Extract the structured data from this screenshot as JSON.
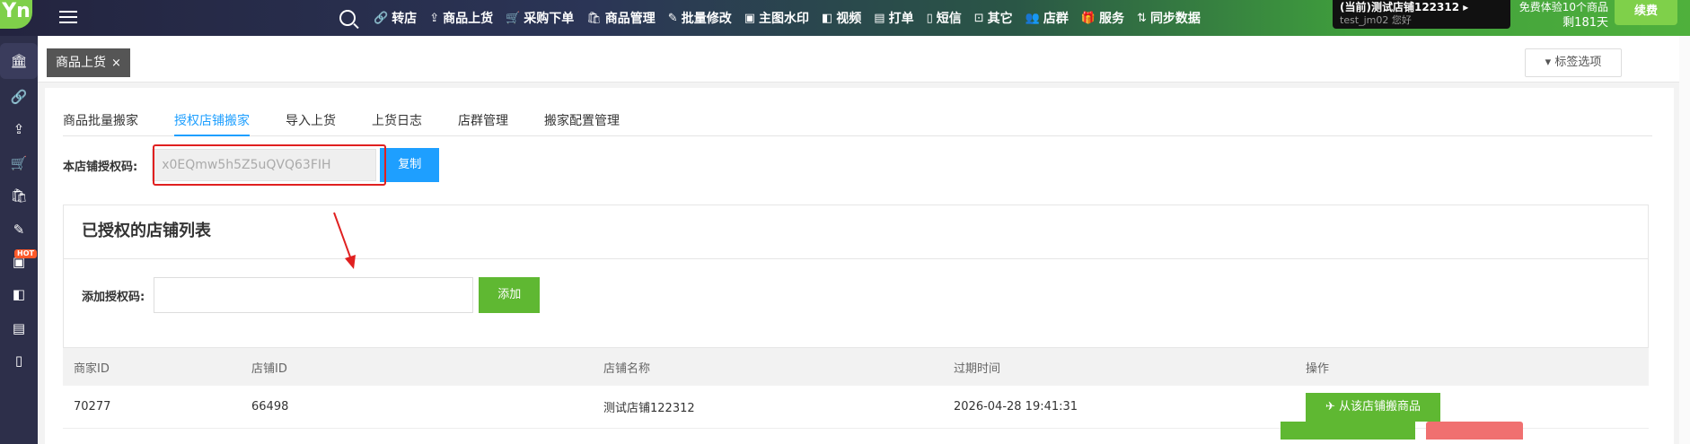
{
  "topbar": {
    "logo": "Yn",
    "nav": [
      {
        "icon": "🔗",
        "label": "转店"
      },
      {
        "icon": "⇪",
        "label": "商品上货"
      },
      {
        "icon": "🛒",
        "label": "采购下单"
      },
      {
        "icon": "🛍",
        "label": "商品管理"
      },
      {
        "icon": "✎",
        "label": "批量修改"
      },
      {
        "icon": "▣",
        "label": "主图水印"
      },
      {
        "icon": "◧",
        "label": "视频"
      },
      {
        "icon": "▤",
        "label": "打单"
      },
      {
        "icon": "▯",
        "label": "短信"
      },
      {
        "icon": "⊡",
        "label": "其它"
      },
      {
        "icon": "👥",
        "label": "店群"
      },
      {
        "icon": "🎁",
        "label": "服务"
      },
      {
        "icon": "⇅",
        "label": "同步数据"
      }
    ],
    "shop_name": "(当前)测试店铺122312 ▸",
    "user_greeting": "test_jm02 您好",
    "trial_text": "免费体验10个商品",
    "days_left": "剩181天",
    "renew_label": "续费"
  },
  "sidebar": {
    "icons": [
      "bank-icon",
      "link-icon",
      "upload-icon",
      "cart-icon",
      "bag-icon",
      "edit-icon",
      "image-hot-icon",
      "video-icon",
      "print-icon",
      "phone-icon"
    ],
    "hot_badge": "HOT"
  },
  "tabs": {
    "active_tag": "商品上货",
    "close": "×",
    "options_label": "▾ 标签选项"
  },
  "subtabs": [
    "商品批量搬家",
    "授权店铺搬家",
    "导入上货",
    "上货日志",
    "店群管理",
    "搬家配置管理"
  ],
  "auth": {
    "label": "本店铺授权码:",
    "code": "x0EQmw5h5Z5uQVQ63FIH",
    "copy_label": "复制"
  },
  "card": {
    "title": "已授权的店铺列表",
    "add_label": "添加授权码:",
    "add_placeholder": "",
    "add_button": "添加"
  },
  "table": {
    "headers": [
      "商家ID",
      "店铺ID",
      "店铺名称",
      "过期时间",
      "操作"
    ],
    "rows": [
      {
        "merchant_id": "70277",
        "shop_id": "66498",
        "shop_name": "测试店铺122312",
        "expire": "2026-04-28 19:41:31",
        "action": "✈ 从该店铺搬商品"
      }
    ]
  },
  "colors": {
    "primary_blue": "#1e9fff",
    "green": "#5fb832",
    "highlight_red": "#e02020"
  }
}
